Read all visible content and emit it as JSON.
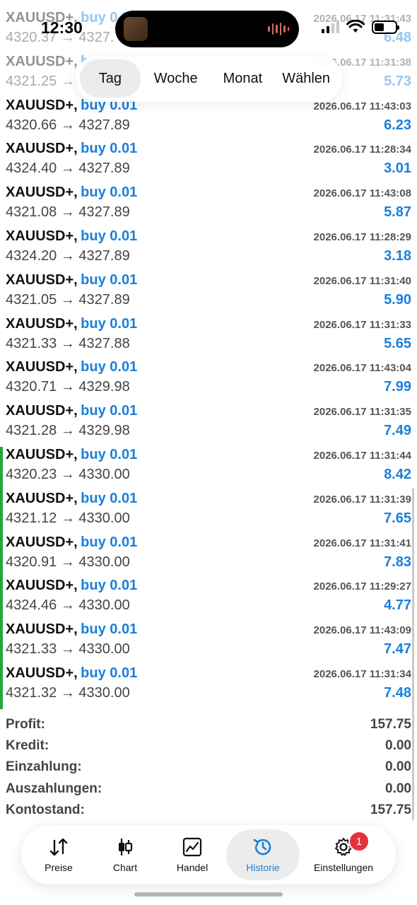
{
  "status_bar": {
    "time": "12:30"
  },
  "period_tabs": [
    {
      "label": "Tag",
      "active": true
    },
    {
      "label": "Woche",
      "active": false
    },
    {
      "label": "Monat",
      "active": false
    },
    {
      "label": "Wählen",
      "active": false
    }
  ],
  "deals": [
    {
      "symbol": "XAUUSD+,",
      "side": "buy 0.01",
      "time": "2026.06.17 11:31:43",
      "prices": "4320.37 → 4327.",
      "profit": "6.48"
    },
    {
      "symbol": "XAUUSD+,",
      "side": "buy 0.01",
      "time": "2026.06.17 11:31:38",
      "prices": "4321.25 →",
      "profit": "5.73"
    },
    {
      "symbol": "XAUUSD+,",
      "side": "buy 0.01",
      "time": "2026.06.17 11:43:03",
      "prices": "4320.66 → 4327.89",
      "profit": "6.23"
    },
    {
      "symbol": "XAUUSD+,",
      "side": "buy 0.01",
      "time": "2026.06.17 11:28:34",
      "prices": "4324.40 → 4327.89",
      "profit": "3.01"
    },
    {
      "symbol": "XAUUSD+,",
      "side": "buy 0.01",
      "time": "2026.06.17 11:43:08",
      "prices": "4321.08 → 4327.89",
      "profit": "5.87"
    },
    {
      "symbol": "XAUUSD+,",
      "side": "buy 0.01",
      "time": "2026.06.17 11:28:29",
      "prices": "4324.20 → 4327.89",
      "profit": "3.18"
    },
    {
      "symbol": "XAUUSD+,",
      "side": "buy 0.01",
      "time": "2026.06.17 11:31:40",
      "prices": "4321.05 → 4327.89",
      "profit": "5.90"
    },
    {
      "symbol": "XAUUSD+,",
      "side": "buy 0.01",
      "time": "2026.06.17 11:31:33",
      "prices": "4321.33 → 4327.88",
      "profit": "5.65"
    },
    {
      "symbol": "XAUUSD+,",
      "side": "buy 0.01",
      "time": "2026.06.17 11:43:04",
      "prices": "4320.71 → 4329.98",
      "profit": "7.99"
    },
    {
      "symbol": "XAUUSD+,",
      "side": "buy 0.01",
      "time": "2026.06.17 11:31:35",
      "prices": "4321.28 → 4329.98",
      "profit": "7.49"
    },
    {
      "symbol": "XAUUSD+,",
      "side": "buy 0.01",
      "time": "2026.06.17 11:31:44",
      "prices": "4320.23 → 4330.00",
      "profit": "8.42"
    },
    {
      "symbol": "XAUUSD+,",
      "side": "buy 0.01",
      "time": "2026.06.17 11:31:39",
      "prices": "4321.12 → 4330.00",
      "profit": "7.65"
    },
    {
      "symbol": "XAUUSD+,",
      "side": "buy 0.01",
      "time": "2026.06.17 11:31:41",
      "prices": "4320.91 → 4330.00",
      "profit": "7.83"
    },
    {
      "symbol": "XAUUSD+,",
      "side": "buy 0.01",
      "time": "2026.06.17 11:29:27",
      "prices": "4324.46 → 4330.00",
      "profit": "4.77"
    },
    {
      "symbol": "XAUUSD+,",
      "side": "buy 0.01",
      "time": "2026.06.17 11:43:09",
      "prices": "4321.33 → 4330.00",
      "profit": "7.47"
    },
    {
      "symbol": "XAUUSD+,",
      "side": "buy 0.01",
      "time": "2026.06.17 11:31:34",
      "prices": "4321.32 → 4330.00",
      "profit": "7.48"
    }
  ],
  "summary": [
    {
      "label": "Profit:",
      "value": "157.75"
    },
    {
      "label": "Kredit:",
      "value": "0.00"
    },
    {
      "label": "Einzahlung:",
      "value": "0.00"
    },
    {
      "label": "Auszahlungen:",
      "value": "0.00"
    },
    {
      "label": "Kontostand:",
      "value": "157.75"
    }
  ],
  "tab_bar": [
    {
      "label": "Preise",
      "icon": "sort-arrows-icon"
    },
    {
      "label": "Chart",
      "icon": "candlestick-icon"
    },
    {
      "label": "Handel",
      "icon": "line-chart-icon"
    },
    {
      "label": "Historie",
      "icon": "history-clock-icon",
      "active": true
    },
    {
      "label": "Einstellungen",
      "icon": "gear-icon",
      "badge": "1"
    }
  ],
  "colors": {
    "accent": "#1a7fdc",
    "marker": "#22a83a",
    "badge": "#e5333b"
  }
}
